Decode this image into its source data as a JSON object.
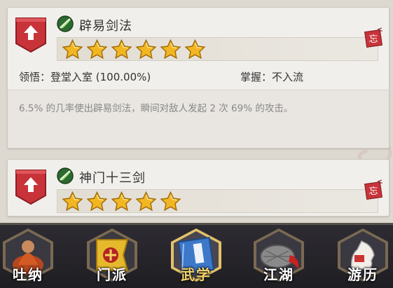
{
  "skills": [
    {
      "name": "辟易剑法",
      "star_count": 6,
      "comprehension": "领悟：登堂入室 (100.00%)",
      "mastery": "掌握：不入流",
      "description": "6.5% 的几率使出辟易剑法，瞬间对敌人发起 2 次 69% 的攻击。",
      "seal_icon": "forget-seal-icon"
    },
    {
      "name": "神门十三剑",
      "star_count": 5,
      "seal_icon": "forget-seal-icon"
    }
  ],
  "nav": {
    "items": [
      {
        "label": "吐纳",
        "icon": "meditation-monk-icon",
        "active": false
      },
      {
        "label": "门派",
        "icon": "sect-banner-icon",
        "active": false
      },
      {
        "label": "武学",
        "icon": "martial-book-icon",
        "active": true
      },
      {
        "label": "江湖",
        "icon": "straw-hat-icon",
        "active": false
      },
      {
        "label": "游历",
        "icon": "white-horse-icon",
        "active": false
      }
    ]
  },
  "colors": {
    "badge_red": "#c8333a",
    "star_gold": "#f2b622",
    "active_gold": "#f2d36b",
    "nav_bg": "#2a282e"
  }
}
